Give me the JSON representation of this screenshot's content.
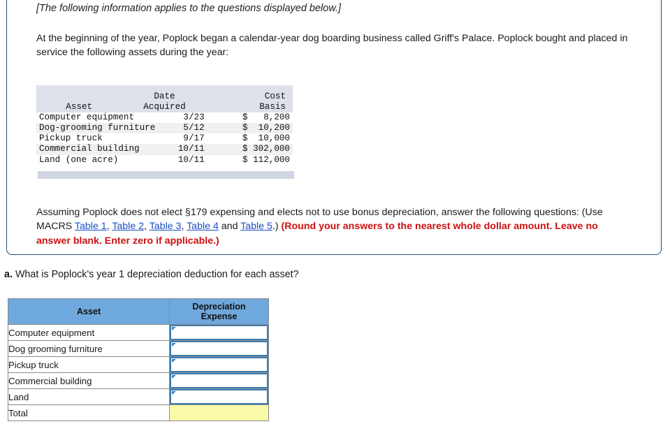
{
  "info_card": {
    "intro_italic": "[The following information applies to the questions displayed below.]",
    "paragraph": "At the beginning of the year, Poplock began a calendar-year dog boarding business called Griff's Palace. Poplock bought and placed in service the following assets during the year:",
    "asset_table": {
      "headers": {
        "asset": "Asset",
        "date_line1": "Date",
        "date_line2": "Acquired",
        "cost_line1": "Cost",
        "cost_line2": "Basis"
      },
      "rows": [
        {
          "asset": "Computer equipment",
          "date": "3/23",
          "cost": "$   8,200"
        },
        {
          "asset": "Dog-grooming furniture",
          "date": "5/12",
          "cost": "$  10,200"
        },
        {
          "asset": "Pickup truck",
          "date": "9/17",
          "cost": "$  10,000"
        },
        {
          "asset": "Commercial building",
          "date": "10/11",
          "cost": "$ 302,000"
        },
        {
          "asset": "Land (one acre)",
          "date": "10/11",
          "cost": "$ 112,000"
        }
      ]
    },
    "closing": {
      "part1": "Assuming Poplock does not elect §179 expensing and elects not to use bonus depreciation, answer the following questions: (Use MACRS ",
      "link1": "Table 1",
      "sep1": ", ",
      "link2": "Table 2",
      "sep2": ", ",
      "link3": "Table 3",
      "sep3": ", ",
      "link4": "Table 4",
      "sep4": " and ",
      "link5": "Table 5",
      "part2": ".) ",
      "red_text": "(Round your answers to the nearest whole dollar amount. Leave no answer blank. Enter zero if applicable.)"
    }
  },
  "question": {
    "marker": "a.",
    "text": "What is Poplock's year 1 depreciation deduction for each asset?"
  },
  "answer_table": {
    "headers": {
      "asset": "Asset",
      "expense_line1": "Depreciation",
      "expense_line2": "Expense"
    },
    "rows": [
      {
        "label": "Computer equipment",
        "value": ""
      },
      {
        "label": "Dog grooming furniture",
        "value": ""
      },
      {
        "label": "Pickup truck",
        "value": ""
      },
      {
        "label": "Commercial building",
        "value": ""
      },
      {
        "label": "Land",
        "value": ""
      }
    ],
    "total_label": "Total",
    "total_value": ""
  },
  "colors": {
    "card_border": "#1f4e79",
    "header_blue": "#6fa8dc",
    "input_border": "#3f7cb4",
    "total_yellow": "#fafaa8",
    "link_blue": "#1a4fc4",
    "red_accent": "#cc1111",
    "mono_header_bg": "#dde1e9",
    "mono_footer_bar": "#cfd5e2"
  }
}
